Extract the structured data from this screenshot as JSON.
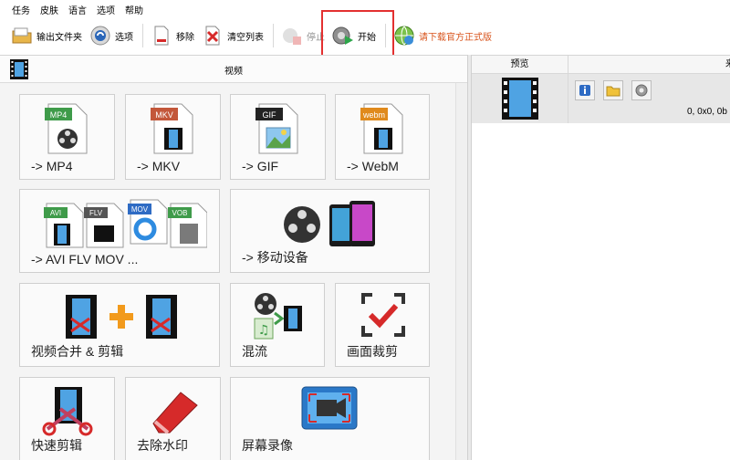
{
  "menu": [
    "任务",
    "皮肤",
    "语言",
    "选项",
    "帮助"
  ],
  "toolbar": {
    "output_folder": "输出文件夹",
    "options": "选项",
    "remove": "移除",
    "clear_list": "清空列表",
    "stop": "停止",
    "start": "开始",
    "download": "请下载官方正式版"
  },
  "panel": {
    "title": "视频"
  },
  "tiles": [
    {
      "label": "-> MP4",
      "badge": "MP4"
    },
    {
      "label": "-> MKV",
      "badge": "MKV"
    },
    {
      "label": "-> GIF",
      "badge": "GIF"
    },
    {
      "label": "-> WebM",
      "badge": "webm"
    },
    {
      "label": "-> AVI FLV MOV ...",
      "badges": [
        "AVI",
        "FLV",
        "MOV",
        "VOB"
      ]
    },
    {
      "label": "-> 移动设备"
    },
    {
      "label": "视频合并 & 剪辑"
    },
    {
      "label": "混流"
    },
    {
      "label": "画面裁剪"
    },
    {
      "label": "快速剪辑"
    },
    {
      "label": "去除水印"
    },
    {
      "label": "屏幕录像"
    }
  ],
  "list": {
    "col_preview": "预览",
    "col_other": "来",
    "row_meta": "0, 0x0, 0b"
  },
  "colors": {
    "highlight": "#e33030",
    "download_text": "#d8541c"
  }
}
